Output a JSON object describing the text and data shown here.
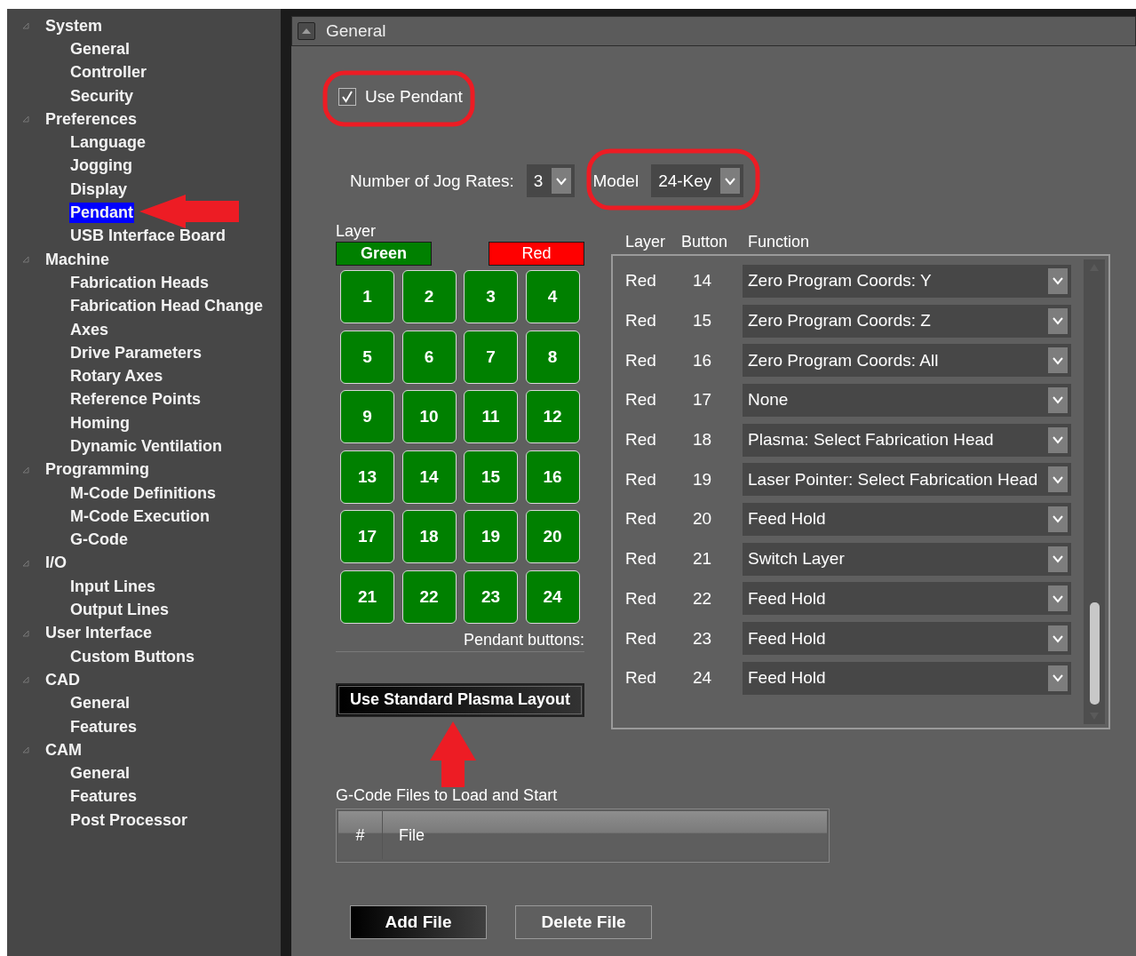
{
  "sidebar": {
    "items": [
      {
        "label": "System",
        "expanded": true,
        "children": [
          {
            "label": "General",
            "selected": false
          },
          {
            "label": "Controller",
            "selected": false
          },
          {
            "label": "Security",
            "selected": false
          }
        ]
      },
      {
        "label": "Preferences",
        "expanded": true,
        "children": [
          {
            "label": "Language",
            "selected": false
          },
          {
            "label": "Jogging",
            "selected": false
          },
          {
            "label": "Display",
            "selected": false
          },
          {
            "label": "Pendant",
            "selected": true
          },
          {
            "label": "USB Interface Board",
            "selected": false
          }
        ]
      },
      {
        "label": "Machine",
        "expanded": true,
        "children": [
          {
            "label": "Fabrication Heads",
            "selected": false
          },
          {
            "label": "Fabrication Head Change",
            "selected": false
          },
          {
            "label": "Axes",
            "selected": false
          },
          {
            "label": "Drive Parameters",
            "selected": false
          },
          {
            "label": "Rotary Axes",
            "selected": false
          },
          {
            "label": "Reference Points",
            "selected": false
          },
          {
            "label": "Homing",
            "selected": false
          },
          {
            "label": "Dynamic Ventilation",
            "selected": false
          }
        ]
      },
      {
        "label": "Programming",
        "expanded": true,
        "children": [
          {
            "label": "M-Code Definitions",
            "selected": false
          },
          {
            "label": "M-Code Execution",
            "selected": false
          },
          {
            "label": "G-Code",
            "selected": false
          }
        ]
      },
      {
        "label": "I/O",
        "expanded": true,
        "children": [
          {
            "label": "Input Lines",
            "selected": false
          },
          {
            "label": "Output Lines",
            "selected": false
          }
        ]
      },
      {
        "label": "User Interface",
        "expanded": true,
        "children": [
          {
            "label": "Custom Buttons",
            "selected": false
          }
        ]
      },
      {
        "label": "CAD",
        "expanded": true,
        "children": [
          {
            "label": "General",
            "selected": false
          },
          {
            "label": "Features",
            "selected": false
          }
        ]
      },
      {
        "label": "CAM",
        "expanded": true,
        "children": [
          {
            "label": "General",
            "selected": false
          },
          {
            "label": "Features",
            "selected": false
          },
          {
            "label": "Post Processor",
            "selected": false
          }
        ]
      }
    ]
  },
  "panel": {
    "title": "General",
    "expanded": true
  },
  "use_pendant": {
    "label": "Use Pendant",
    "checked": true
  },
  "jog_rates": {
    "label": "Number of Jog Rates:",
    "value": "3"
  },
  "model": {
    "label": "Model",
    "value": "24-Key"
  },
  "layer": {
    "label": "Layer",
    "options": [
      {
        "label": "Green",
        "color": "#008000",
        "selected": true
      },
      {
        "label": "Red",
        "color": "#ff0000",
        "selected": false
      }
    ]
  },
  "pendant_buttons": {
    "caption": "Pendant buttons:",
    "keys": [
      "1",
      "2",
      "3",
      "4",
      "5",
      "6",
      "7",
      "8",
      "9",
      "10",
      "11",
      "12",
      "13",
      "14",
      "15",
      "16",
      "17",
      "18",
      "19",
      "20",
      "21",
      "22",
      "23",
      "24"
    ]
  },
  "standard_layout_button": "Use Standard Plasma Layout",
  "mapping_table": {
    "columns": [
      "Layer",
      "Button",
      "Function"
    ],
    "rows": [
      {
        "layer": "Red",
        "button": "14",
        "function": "Zero Program Coords: Y"
      },
      {
        "layer": "Red",
        "button": "15",
        "function": "Zero Program Coords: Z"
      },
      {
        "layer": "Red",
        "button": "16",
        "function": "Zero Program Coords: All"
      },
      {
        "layer": "Red",
        "button": "17",
        "function": "None"
      },
      {
        "layer": "Red",
        "button": "18",
        "function": "Plasma: Select Fabrication Head"
      },
      {
        "layer": "Red",
        "button": "19",
        "function": "Laser Pointer: Select Fabrication Head"
      },
      {
        "layer": "Red",
        "button": "20",
        "function": "Feed Hold"
      },
      {
        "layer": "Red",
        "button": "21",
        "function": "Switch Layer"
      },
      {
        "layer": "Red",
        "button": "22",
        "function": "Feed Hold"
      },
      {
        "layer": "Red",
        "button": "23",
        "function": "Feed Hold"
      },
      {
        "layer": "Red",
        "button": "24",
        "function": "Feed Hold"
      }
    ]
  },
  "gcode_files": {
    "label": "G-Code Files to Load and Start",
    "columns": [
      "#",
      "File"
    ]
  },
  "buttons": [
    {
      "label": "Add File",
      "kind": "primary"
    },
    {
      "label": "Delete File",
      "kind": "plain"
    }
  ]
}
